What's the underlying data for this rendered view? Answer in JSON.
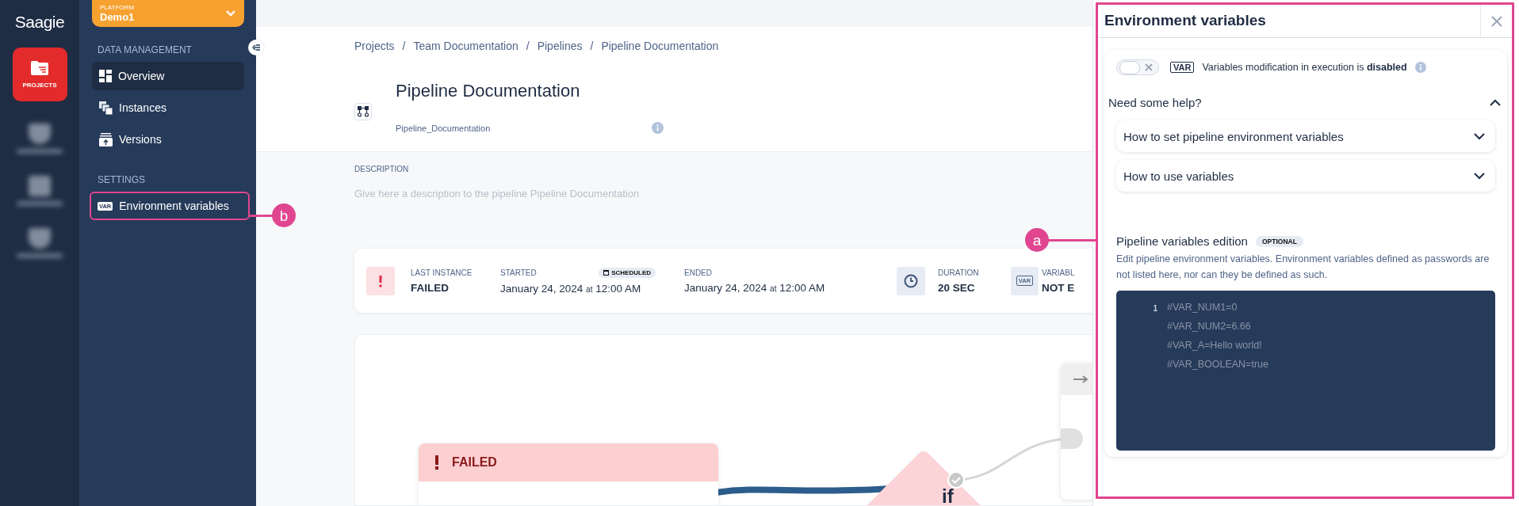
{
  "rail": {
    "logo": "Saagie",
    "items": [
      {
        "label": "PROJECTS",
        "selected": true
      }
    ]
  },
  "platform": {
    "label": "PLATFORM",
    "name": "Demo1"
  },
  "sidebar": {
    "sections": [
      {
        "title": "DATA MANAGEMENT",
        "items": [
          {
            "label": "Overview",
            "kind": "grid",
            "selected": true,
            "highlighted": false
          },
          {
            "label": "Instances",
            "kind": "stack",
            "selected": false,
            "highlighted": false
          },
          {
            "label": "Versions",
            "kind": "upload",
            "selected": false,
            "highlighted": false
          }
        ]
      },
      {
        "title": "SETTINGS",
        "items": [
          {
            "label": "Environment variables",
            "kind": "var",
            "icon_text": "VAR",
            "selected": false,
            "highlighted": true
          }
        ]
      }
    ]
  },
  "breadcrumb": {
    "separator": "/",
    "items": [
      "Projects",
      "Team Documentation",
      "Pipelines",
      "Pipeline Documentation"
    ]
  },
  "pipeline": {
    "title": "Pipeline Documentation",
    "technical_name": "Pipeline_Documentation"
  },
  "description": {
    "label": "DESCRIPTION",
    "placeholder": "Give here a description to the pipeline Pipeline Documentation"
  },
  "last_instance": {
    "label": "LAST INSTANCE",
    "status": "FAILED",
    "started_label": "STARTED",
    "badge": "SCHEDULED",
    "started": {
      "date": "January 24, 2024",
      "at": "at",
      "time": "12:00 AM"
    },
    "ended_label": "ENDED",
    "ended": {
      "date": "January 24, 2024",
      "at": "at",
      "time": "12:00 AM"
    },
    "duration_label": "DURATION",
    "duration": "20 SEC",
    "variables_icon": "VAR",
    "variables_label": "VARIABL",
    "variables": "NOT E"
  },
  "canvas": {
    "nodes": [
      {
        "kind": "job",
        "status": "FAILED"
      },
      {
        "kind": "condition",
        "label": "if"
      },
      {
        "kind": "job"
      }
    ]
  },
  "panel": {
    "title": "Environment variables",
    "toggle": {
      "on": false
    },
    "var_icon": "VAR",
    "toggle_text": "Variables modification in execution is **disabled**",
    "help": {
      "title": "Need some help?",
      "expanded": true,
      "items": [
        {
          "label": "How to set pipeline environment variables",
          "expanded": false
        },
        {
          "label": "How to use variables",
          "expanded": false
        }
      ]
    },
    "editor": {
      "title": "Pipeline variables edition",
      "badge": "OPTIONAL",
      "description": "Edit pipeline environment variables. Environment variables defined as passwords are not listed here, nor can they be defined as such.",
      "line_numbers": [
        "1"
      ],
      "lines": [
        "#VAR_NUM1=0",
        "#VAR_NUM2=6.66",
        "#VAR_A=Hello world!",
        "#VAR_BOOLEAN=true"
      ]
    }
  },
  "annotations": [
    {
      "label": "a"
    },
    {
      "label": "b"
    }
  ]
}
